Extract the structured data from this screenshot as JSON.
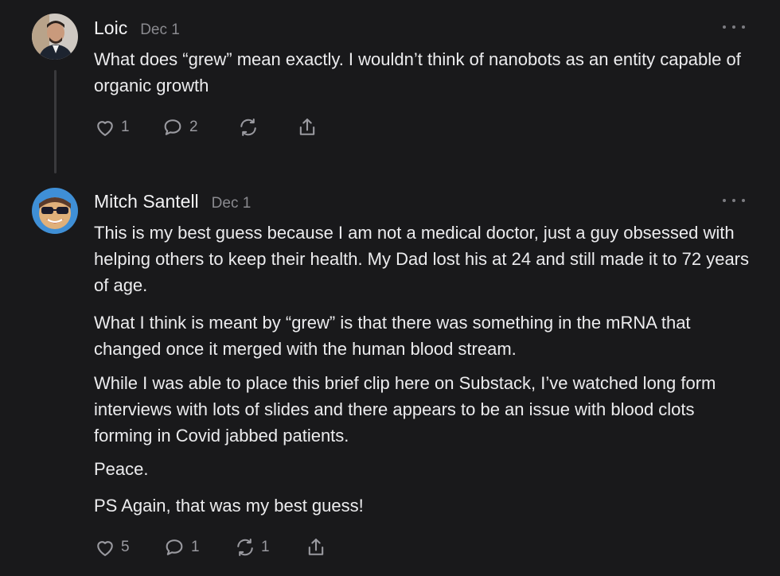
{
  "comments": [
    {
      "author": "Loic",
      "date": "Dec 1",
      "paragraphs": [
        "What does “grew” mean exactly. I wouldn’t think of nanobots as an entity capable of organic growth"
      ],
      "likes": "1",
      "replies": "2",
      "restacks": "",
      "icons": [
        "heart-icon",
        "comment-icon",
        "restack-icon",
        "share-icon",
        "more-icon"
      ]
    },
    {
      "author": "Mitch Santell",
      "date": "Dec 1",
      "paragraphs": [
        "This is my best guess because I am not a medical doctor, just a guy obsessed with helping others to keep their health. My Dad lost his at 24 and still made it to 72 years of age.",
        "What I think is meant by “grew” is that there was something in the mRNA that changed once it merged with the human blood stream.",
        "While I was able to place this brief clip here on Substack, I’ve watched long form interviews with lots of slides and there appears to be an issue with blood clots forming in Covid jabbed patients.",
        "Peace.",
        "PS Again, that was my best guess!"
      ],
      "likes": "5",
      "replies": "1",
      "restacks": "1",
      "icons": [
        "heart-icon",
        "comment-icon",
        "restack-icon",
        "share-icon",
        "more-icon"
      ]
    }
  ],
  "colors": {
    "background": "#19191b",
    "text": "#ececee",
    "muted": "#8a8a8f",
    "icon": "#9a9aa0",
    "thread_line": "#3a3a3d"
  }
}
